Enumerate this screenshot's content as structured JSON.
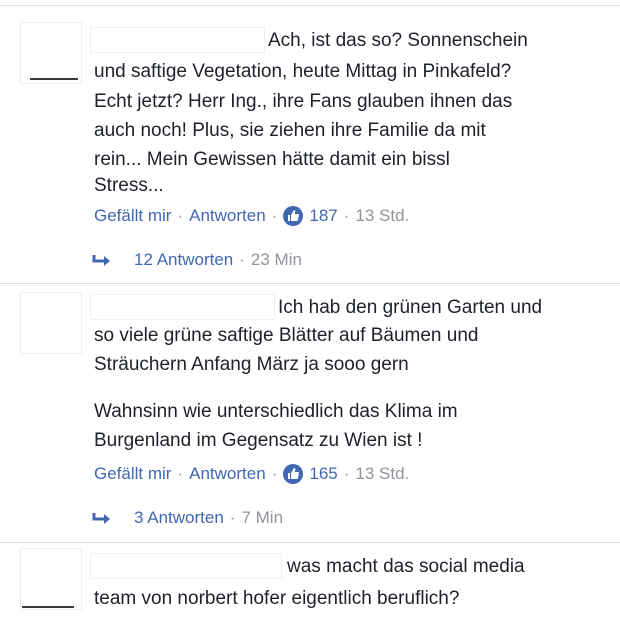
{
  "comments": [
    {
      "lines": [
        "Ach, ist das so? Sonnenschein",
        "und saftige Vegetation, heute Mittag in Pinkafeld?",
        "Echt jetzt? Herr Ing., ihre Fans glauben ihnen das",
        "auch noch! Plus, sie ziehen ihre Familie da mit",
        "rein... Mein Gewissen hätte damit ein bissl",
        "Stress..."
      ],
      "like_label": "Gefällt mir",
      "reply_label": "Antworten",
      "like_count": "187",
      "time": "13 Std.",
      "replies_label": "12 Antworten",
      "replies_time": "23 Min"
    },
    {
      "lines": [
        "Ich hab den grünen Garten und",
        "so viele grüne saftige Blätter auf Bäumen und",
        "Sträuchern Anfang März ja sooo gern",
        "Wahnsinn wie unterschiedlich das Klima im",
        "Burgenland im Gegensatz zu Wien ist !"
      ],
      "like_label": "Gefällt mir",
      "reply_label": "Antworten",
      "like_count": "165",
      "time": "13 Std.",
      "replies_label": "3 Antworten",
      "replies_time": "7 Min"
    },
    {
      "lines": [
        "was macht das social media",
        "team von norbert hofer eigentlich beruflich?"
      ]
    }
  ],
  "separator": "·",
  "colors": {
    "link": "#4267b2",
    "meta": "#90949c",
    "text": "#1d2129",
    "like_badge": "#4267b2"
  },
  "icons": {
    "like": "thumbs-up-icon",
    "reply": "reply-arrow-icon"
  }
}
